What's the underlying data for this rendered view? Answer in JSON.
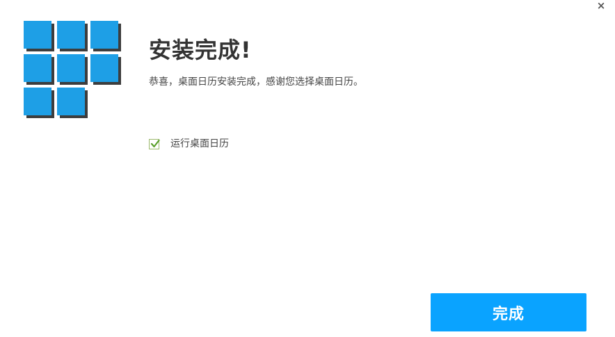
{
  "window": {
    "close_glyph": "×"
  },
  "logo": {
    "icon": "calendar-grid-logo-icon",
    "tile_color": "#1e9fe6",
    "shadow_color": "#3d3d3d"
  },
  "header": {
    "title": "安装完成!",
    "subtitle": "恭喜，桌面日历安装完成，感谢您选择桌面日历。"
  },
  "options": {
    "run_app_label": "运行桌面日历",
    "run_app_checked": true
  },
  "footer": {
    "finish_label": "完成",
    "accent_color": "#0aa3ff"
  }
}
